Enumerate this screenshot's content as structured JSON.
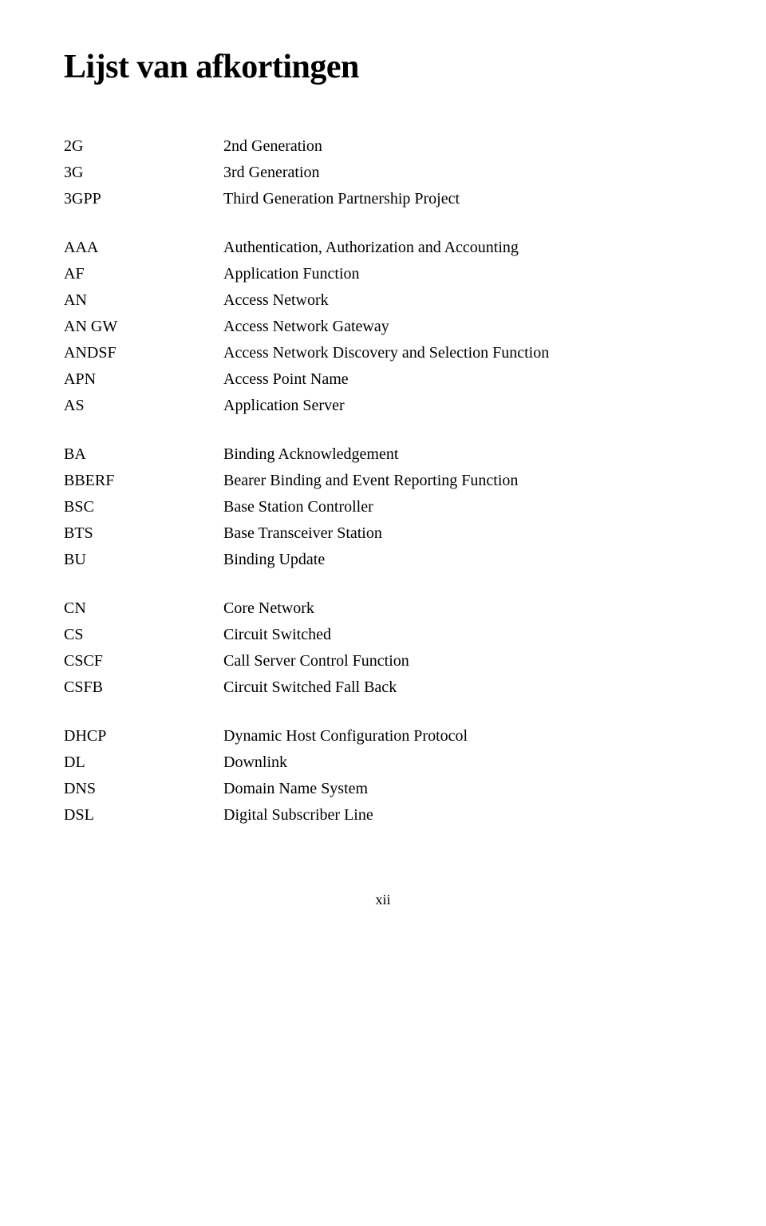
{
  "title": "Lijst van afkortingen",
  "groups": [
    {
      "items": [
        {
          "term": "2G",
          "definition": "2nd Generation"
        },
        {
          "term": "3G",
          "definition": "3rd Generation"
        },
        {
          "term": "3GPP",
          "definition": "Third Generation Partnership Project"
        }
      ]
    },
    {
      "items": [
        {
          "term": "AAA",
          "definition": "Authentication, Authorization and Accounting"
        },
        {
          "term": "AF",
          "definition": "Application Function"
        },
        {
          "term": "AN",
          "definition": "Access Network"
        },
        {
          "term": "AN GW",
          "definition": "Access Network Gateway"
        },
        {
          "term": "ANDSF",
          "definition": "Access Network Discovery and Selection Function"
        },
        {
          "term": "APN",
          "definition": "Access Point Name"
        },
        {
          "term": "AS",
          "definition": "Application Server"
        }
      ]
    },
    {
      "items": [
        {
          "term": "BA",
          "definition": "Binding Acknowledgement"
        },
        {
          "term": "BBERF",
          "definition": "Bearer Binding and Event Reporting Function"
        },
        {
          "term": "BSC",
          "definition": "Base Station Controller"
        },
        {
          "term": "BTS",
          "definition": "Base Transceiver Station"
        },
        {
          "term": "BU",
          "definition": "Binding Update"
        }
      ]
    },
    {
      "items": [
        {
          "term": "CN",
          "definition": "Core Network"
        },
        {
          "term": "CS",
          "definition": "Circuit Switched"
        },
        {
          "term": "CSCF",
          "definition": "Call Server Control Function"
        },
        {
          "term": "CSFB",
          "definition": "Circuit Switched Fall Back"
        }
      ]
    },
    {
      "items": [
        {
          "term": "DHCP",
          "definition": "Dynamic Host Configuration Protocol"
        },
        {
          "term": "DL",
          "definition": "Downlink"
        },
        {
          "term": "DNS",
          "definition": "Domain Name System"
        },
        {
          "term": "DSL",
          "definition": "Digital Subscriber Line"
        }
      ]
    }
  ],
  "footer": {
    "page_number": "xii"
  }
}
